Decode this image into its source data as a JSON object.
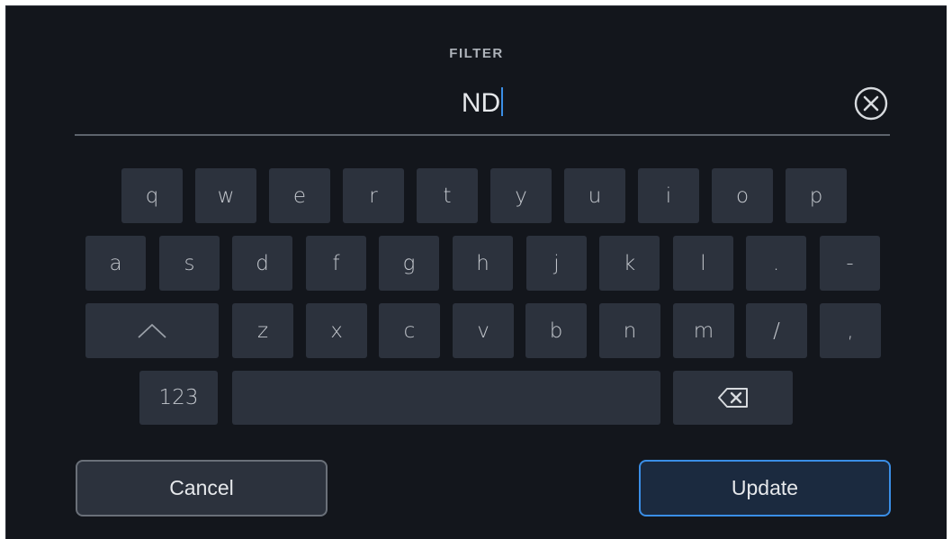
{
  "field": {
    "title": "FILTER",
    "value": "ND"
  },
  "keyboard": {
    "row1": [
      "q",
      "w",
      "e",
      "r",
      "t",
      "y",
      "u",
      "i",
      "o",
      "p"
    ],
    "row2": [
      "a",
      "s",
      "d",
      "f",
      "g",
      "h",
      "j",
      "k",
      "l",
      ".",
      "-"
    ],
    "row3": [
      "z",
      "x",
      "c",
      "v",
      "b",
      "n",
      "m",
      "/",
      ","
    ],
    "numbers_label": "123"
  },
  "actions": {
    "cancel_label": "Cancel",
    "update_label": "Update"
  },
  "colors": {
    "background": "#13161c",
    "key": "#2c323d",
    "accent": "#3a8ee6"
  },
  "icons": {
    "clear": "clear-circle-x-icon",
    "shift": "shift-chevron-up-icon",
    "backspace": "backspace-icon"
  }
}
